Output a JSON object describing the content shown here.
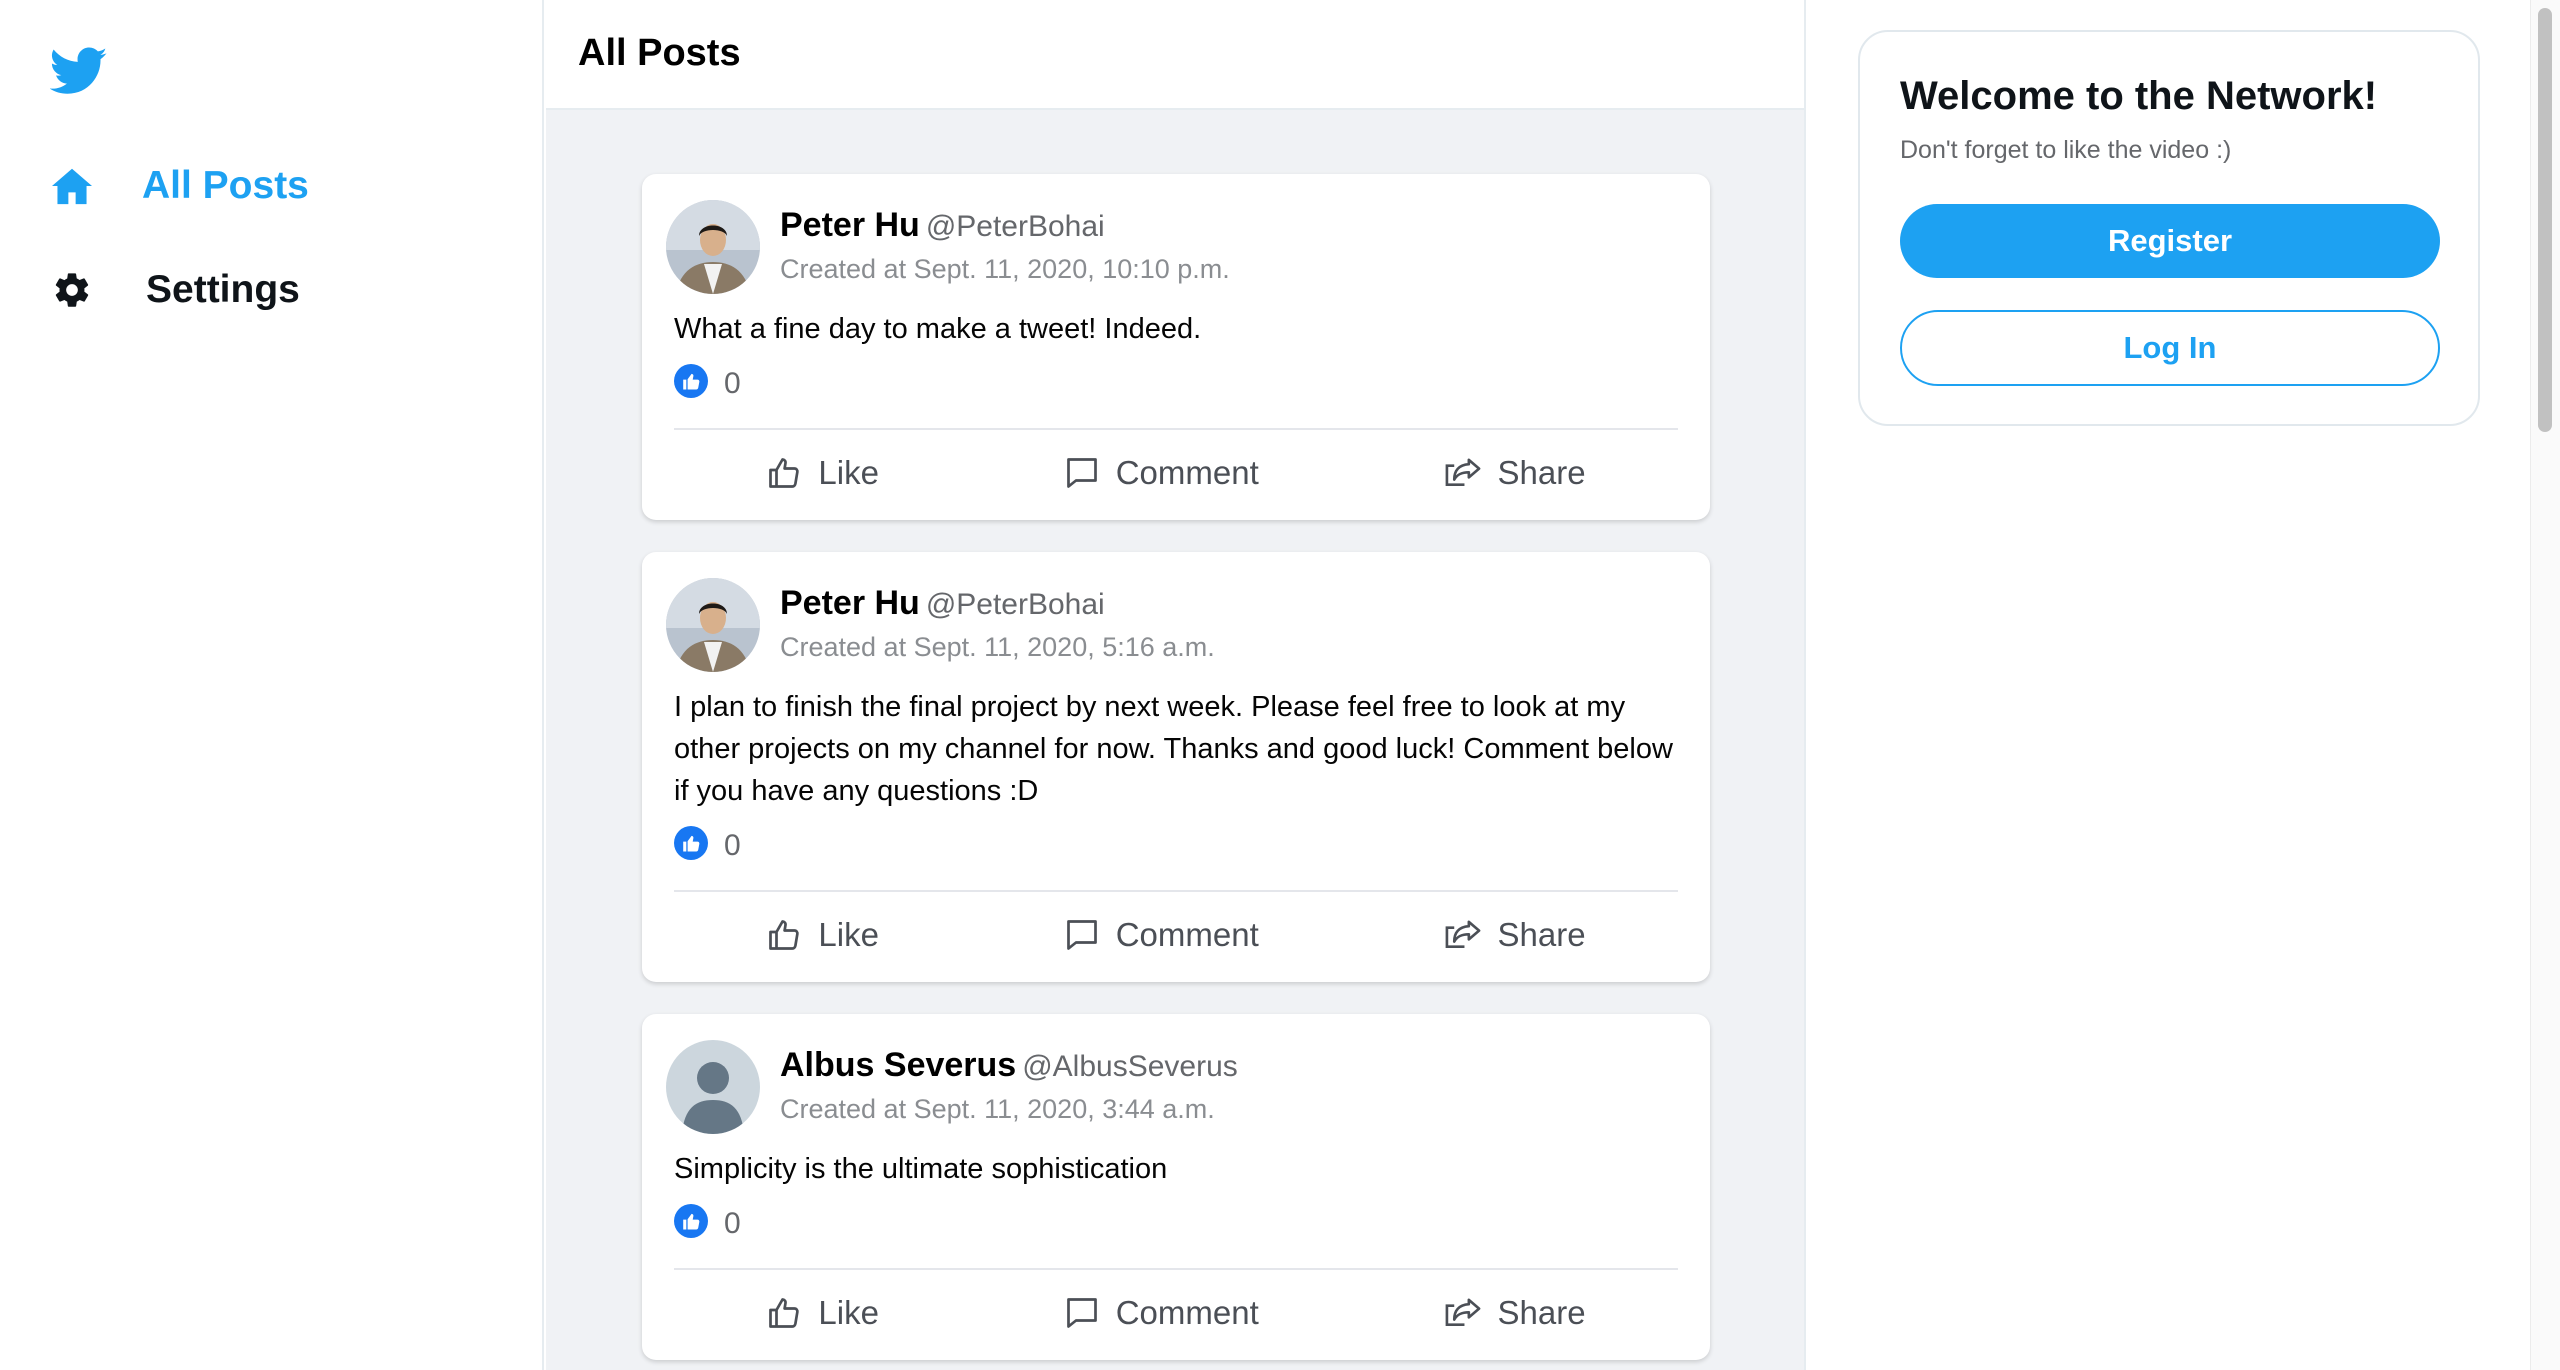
{
  "nav": {
    "logo_icon": "twitter-bird-icon",
    "items": [
      {
        "label": "All Posts",
        "icon": "home-icon",
        "active": true
      },
      {
        "label": "Settings",
        "icon": "gear-icon",
        "active": false
      }
    ]
  },
  "feed": {
    "title": "All Posts",
    "posts": [
      {
        "author": "Peter Hu",
        "handle": "@PeterBohai",
        "created": "Created at Sept. 11, 2020, 10:10 p.m.",
        "body": "What a fine day to make a tweet! Indeed.",
        "likes": "0",
        "avatar": "photo"
      },
      {
        "author": "Peter Hu",
        "handle": "@PeterBohai",
        "created": "Created at Sept. 11, 2020, 5:16 a.m.",
        "body": "I plan to finish the final project by next week. Please feel free to look at my other projects on my channel for now. Thanks and good luck! Comment below if you have any questions :D",
        "likes": "0",
        "avatar": "photo"
      },
      {
        "author": "Albus Severus",
        "handle": "@AlbusSeverus",
        "created": "Created at Sept. 11, 2020, 3:44 a.m.",
        "body": "Simplicity is the ultimate sophistication",
        "likes": "0",
        "avatar": "default"
      }
    ],
    "actions": {
      "like": "Like",
      "comment": "Comment",
      "share": "Share"
    }
  },
  "welcome": {
    "title": "Welcome to the Network!",
    "subtitle": "Don't forget to like the video :)",
    "register": "Register",
    "login": "Log In"
  },
  "colors": {
    "accent": "#1da1f2",
    "feed_bg": "#f0f2f5",
    "like_blue": "#1877f2"
  }
}
